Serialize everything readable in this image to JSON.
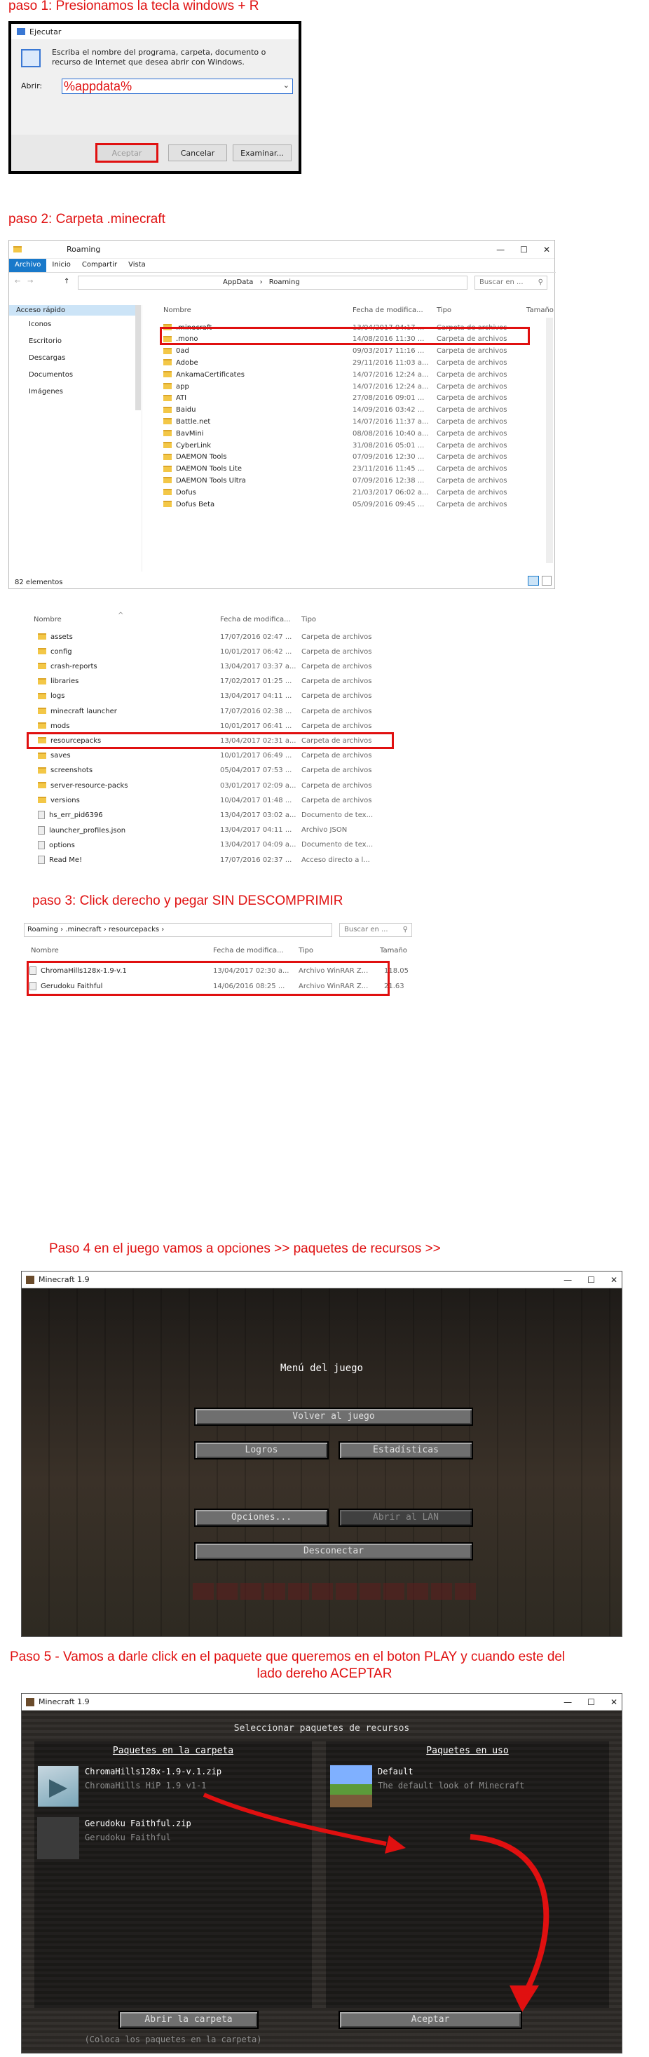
{
  "steps": {
    "s1": "paso 1: Presionamos la tecla windows + R",
    "s2": "paso 2: Carpeta .minecraft",
    "s3": "paso 3: Click derecho y pegar SIN DESCOMPRIMIR",
    "s4": "Paso 4 en el juego vamos a opciones >> paquetes de recursos >>",
    "s5a": "Paso 5 - Vamos a darle click en el paquete que queremos en el boton PLAY y cuando este del",
    "s5b": "lado dereho ACEPTAR"
  },
  "run": {
    "title": "Ejecutar",
    "desc": "Escriba el nombre del programa, carpeta, documento o recurso de Internet que desea abrir con Windows.",
    "open_label": "Abrir:",
    "value": "%appdata%",
    "ok": "Aceptar",
    "cancel": "Cancelar",
    "browse": "Examinar..."
  },
  "explorer": {
    "title": "Roaming",
    "tabs": [
      "Archivo",
      "Inicio",
      "Compartir",
      "Vista"
    ],
    "path": [
      "AppData",
      "Roaming"
    ],
    "search_placeholder": "Buscar en ...",
    "columns": [
      "Nombre",
      "Fecha de modifica...",
      "Tipo",
      "Tamaño"
    ],
    "sidebar": [
      "Acceso rápido",
      "Iconos",
      "Escritorio",
      "Descargas",
      "Documentos",
      "Imágenes"
    ],
    "rows": [
      {
        "name": ".minecraft",
        "date": "13/04/2017 04:17 ...",
        "type": "Carpeta de archivos"
      },
      {
        "name": ".mono",
        "date": "14/08/2016 11:30 ...",
        "type": "Carpeta de archivos"
      },
      {
        "name": "0ad",
        "date": "09/03/2017 11:16 ...",
        "type": "Carpeta de archivos"
      },
      {
        "name": "Adobe",
        "date": "29/11/2016 11:03 a...",
        "type": "Carpeta de archivos"
      },
      {
        "name": "AnkamaCertificates",
        "date": "14/07/2016 12:24 a...",
        "type": "Carpeta de archivos"
      },
      {
        "name": "app",
        "date": "14/07/2016 12:24 a...",
        "type": "Carpeta de archivos"
      },
      {
        "name": "ATI",
        "date": "27/08/2016 09:01 ...",
        "type": "Carpeta de archivos"
      },
      {
        "name": "Baidu",
        "date": "14/09/2016 03:42 ...",
        "type": "Carpeta de archivos"
      },
      {
        "name": "Battle.net",
        "date": "14/07/2016 11:37 a...",
        "type": "Carpeta de archivos"
      },
      {
        "name": "BavMini",
        "date": "08/08/2016 10:40 a...",
        "type": "Carpeta de archivos"
      },
      {
        "name": "CyberLink",
        "date": "31/08/2016 05:01 ...",
        "type": "Carpeta de archivos"
      },
      {
        "name": "DAEMON Tools",
        "date": "07/09/2016 12:30 ...",
        "type": "Carpeta de archivos"
      },
      {
        "name": "DAEMON Tools Lite",
        "date": "23/11/2016 11:45 ...",
        "type": "Carpeta de archivos"
      },
      {
        "name": "DAEMON Tools Ultra",
        "date": "07/09/2016 12:38 ...",
        "type": "Carpeta de archivos"
      },
      {
        "name": "Dofus",
        "date": "21/03/2017 06:02 a...",
        "type": "Carpeta de archivos"
      },
      {
        "name": "Dofus Beta",
        "date": "05/09/2016 09:45 ...",
        "type": "Carpeta de archivos"
      }
    ],
    "status": "82 elementos"
  },
  "mcfolder": {
    "columns": [
      "Nombre",
      "Fecha de modifica...",
      "Tipo"
    ],
    "rows": [
      {
        "name": "assets",
        "date": "17/07/2016 02:47 ...",
        "type": "Carpeta de archivos",
        "icon": "folder"
      },
      {
        "name": "config",
        "date": "10/01/2017 06:42 ...",
        "type": "Carpeta de archivos",
        "icon": "folder"
      },
      {
        "name": "crash-reports",
        "date": "13/04/2017 03:37 a...",
        "type": "Carpeta de archivos",
        "icon": "folder"
      },
      {
        "name": "libraries",
        "date": "17/02/2017 01:25 ...",
        "type": "Carpeta de archivos",
        "icon": "folder"
      },
      {
        "name": "logs",
        "date": "13/04/2017 04:11 ...",
        "type": "Carpeta de archivos",
        "icon": "folder"
      },
      {
        "name": "minecraft launcher",
        "date": "17/07/2016 02:38 ...",
        "type": "Carpeta de archivos",
        "icon": "folder"
      },
      {
        "name": "mods",
        "date": "10/01/2017 06:41 ...",
        "type": "Carpeta de archivos",
        "icon": "folder"
      },
      {
        "name": "resourcepacks",
        "date": "13/04/2017 02:31 a...",
        "type": "Carpeta de archivos",
        "icon": "folder"
      },
      {
        "name": "saves",
        "date": "10/01/2017 06:49 ...",
        "type": "Carpeta de archivos",
        "icon": "folder"
      },
      {
        "name": "screenshots",
        "date": "05/04/2017 07:53 ...",
        "type": "Carpeta de archivos",
        "icon": "folder"
      },
      {
        "name": "server-resource-packs",
        "date": "03/01/2017 02:09 a...",
        "type": "Carpeta de archivos",
        "icon": "folder"
      },
      {
        "name": "versions",
        "date": "10/04/2017 01:48 ...",
        "type": "Carpeta de archivos",
        "icon": "folder"
      },
      {
        "name": "hs_err_pid6396",
        "date": "13/04/2017 03:02 a...",
        "type": "Documento de tex...",
        "icon": "file"
      },
      {
        "name": "launcher_profiles.json",
        "date": "13/04/2017 04:11 ...",
        "type": "Archivo JSON",
        "icon": "file"
      },
      {
        "name": "options",
        "date": "13/04/2017 04:09 a...",
        "type": "Documento de tex...",
        "icon": "file"
      },
      {
        "name": "Read Me!",
        "date": "17/07/2016 02:37 ...",
        "type": "Acceso directo a l...",
        "icon": "file"
      }
    ]
  },
  "rp": {
    "path": [
      "Roaming",
      ".minecraft",
      "resourcepacks"
    ],
    "search_placeholder": "Buscar en ...",
    "columns": [
      "Nombre",
      "Fecha de modifica...",
      "Tipo",
      "Tamaño"
    ],
    "rows": [
      {
        "name": "ChromaHills128x-1.9-v.1",
        "date": "13/04/2017 02:30 a...",
        "type": "Archivo WinRAR Z...",
        "size": "118.05"
      },
      {
        "name": "Gerudoku Faithful",
        "date": "14/06/2016 08:25 ...",
        "type": "Archivo WinRAR Z...",
        "size": "21.63"
      }
    ]
  },
  "mc1": {
    "title": "Minecraft 1.9",
    "menu_title": "Menú del juego",
    "back": "Volver al juego",
    "achievements": "Logros",
    "stats": "Estadísticas",
    "options": "Opciones...",
    "lan": "Abrir al LAN",
    "disconnect": "Desconectar"
  },
  "mc2": {
    "title": "Minecraft 1.9",
    "heading": "Seleccionar paquetes de recursos",
    "available": "Paquetes en la carpeta",
    "selected": "Paquetes en uso",
    "packs": [
      {
        "name": "ChromaHills128x-1.9-v.1.zip",
        "desc": "ChromaHills HiP 1.9 v1-1"
      },
      {
        "name": "Gerudoku Faithful.zip",
        "desc": "Gerudoku Faithful"
      }
    ],
    "default_name": "Default",
    "default_desc": "The default look of Minecraft",
    "open_folder": "Abrir la carpeta",
    "note": "(Coloca los paquetes en la carpeta)",
    "accept": "Aceptar"
  },
  "colors": {
    "accent": "#e01010",
    "explorer_blue": "#1979ca",
    "mc_bg": "#2a2520"
  }
}
